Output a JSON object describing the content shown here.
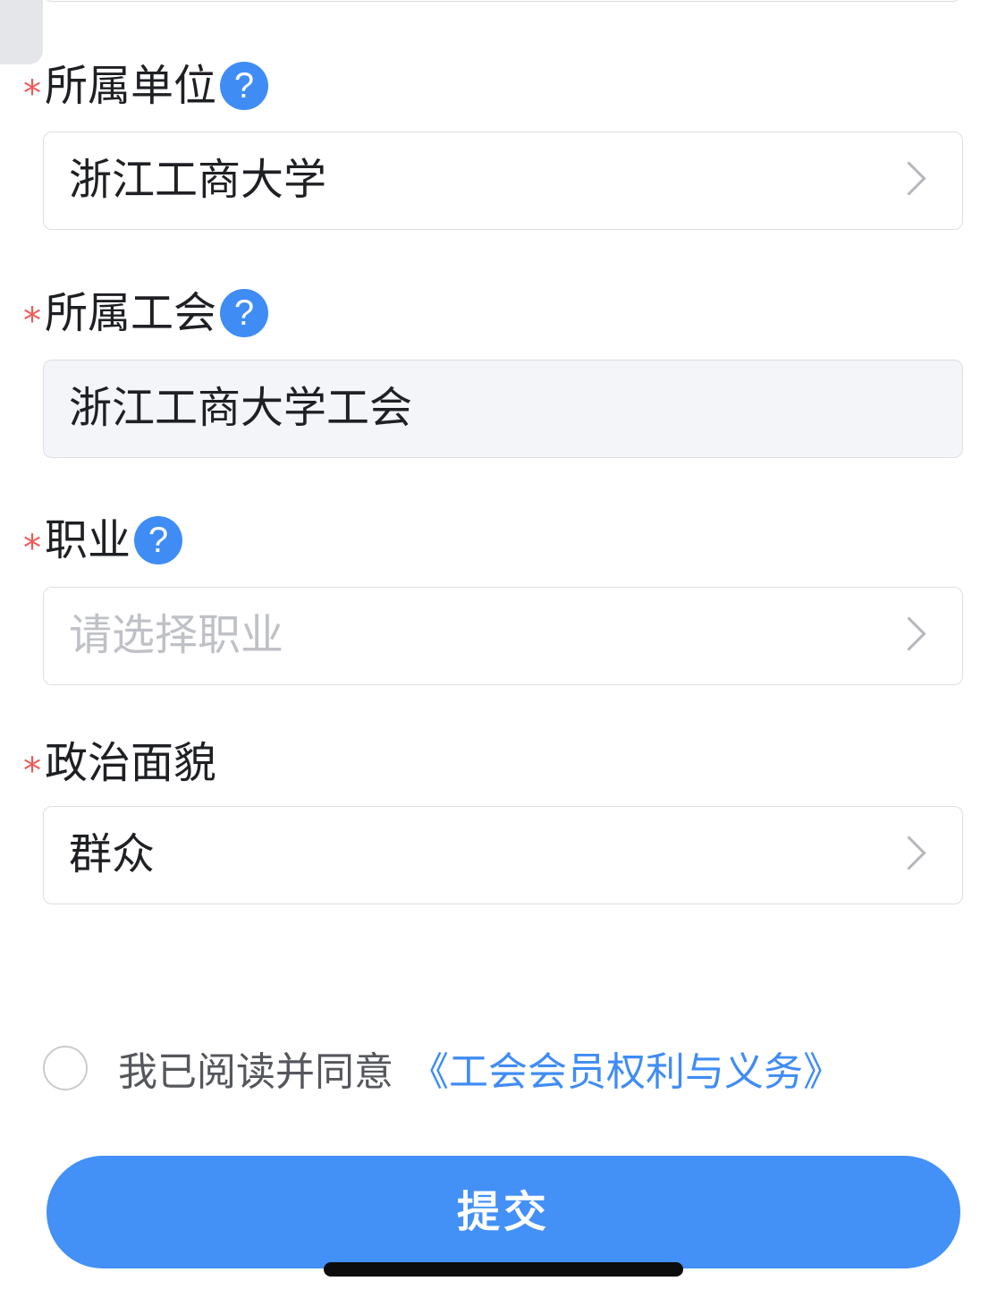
{
  "form": {
    "unit": {
      "required": "*",
      "label": "所属单位",
      "help": "?",
      "value": "浙江工商大学"
    },
    "union": {
      "required": "*",
      "label": "所属工会",
      "help": "?",
      "value": "浙江工商大学工会"
    },
    "occupation": {
      "required": "*",
      "label": "职业",
      "help": "?",
      "placeholder": "请选择职业"
    },
    "political_status": {
      "required": "*",
      "label": "政治面貌",
      "value": "群众"
    }
  },
  "agreement": {
    "text": "我已阅读并同意",
    "link": "《工会会员权利与义务》"
  },
  "submit_label": "提交",
  "colors": {
    "primary": "#4390f7",
    "required": "#ee5a5a",
    "help_icon": "#3f8cf5",
    "border": "#dcdee2",
    "disabled_bg": "#f4f5f8",
    "placeholder": "#bfc1c6"
  }
}
